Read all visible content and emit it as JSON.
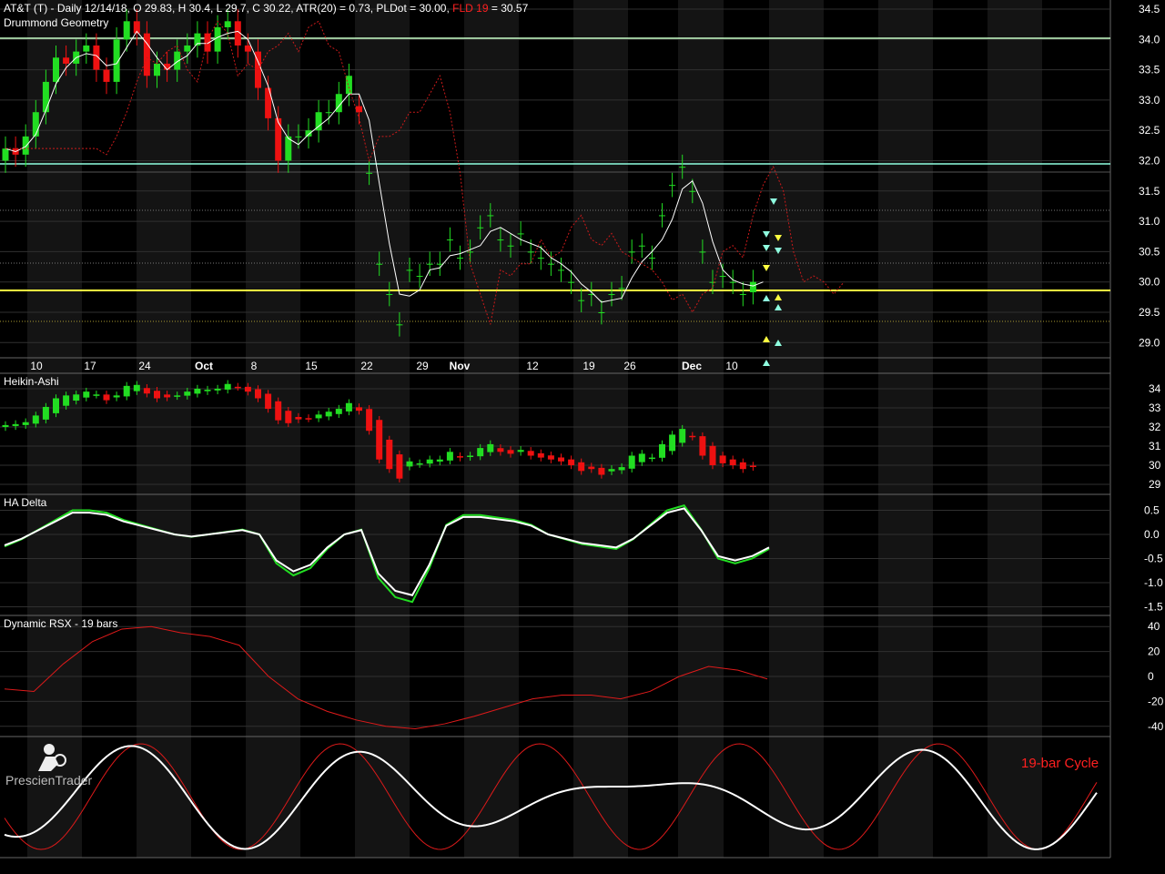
{
  "header": {
    "line1_a": "AT&T (T) - Daily 12/14/18, O 29.83, H 30.4, L 29.7, C 30.22, ATR(20) = 0.73, PLDot = 30.00,",
    "line1_fld": "FLD 19",
    "line1_b": "= 30.57",
    "panel1_title": "Drummond Geometry"
  },
  "panels": {
    "heikin_title": "Heikin-Ashi",
    "delta_title": "HA Delta",
    "rsx_title": "Dynamic RSX - 19 bars",
    "cycle_label": "19-bar Cycle"
  },
  "logo": {
    "text": "PrescienTrader",
    "icon": "trader-figure-icon"
  },
  "colors": {
    "bull": "#22dd22",
    "bear": "#ee1111",
    "grid": "#303030",
    "yellow": "#ffff40",
    "cyan": "#8fffe0"
  },
  "chart_data": [
    {
      "type": "candlestick",
      "title": "AT&T (T) - Daily",
      "x_tick_labels": [
        "10",
        "17",
        "24",
        "Oct",
        "8",
        "15",
        "22",
        "29",
        "Nov",
        "12",
        "19",
        "26",
        "Dec",
        "10"
      ],
      "y_ticks": [
        "34.5",
        "34.0",
        "33.5",
        "33.0",
        "32.5",
        "32.0",
        "31.5",
        "31.0",
        "30.5",
        "30.0",
        "29.5",
        "29.0"
      ],
      "ylim": [
        28.7,
        34.6
      ],
      "closes": [
        32.2,
        32.1,
        32.4,
        32.8,
        33.3,
        33.7,
        33.6,
        33.8,
        33.9,
        33.5,
        33.3,
        34.0,
        34.3,
        34.1,
        33.4,
        33.6,
        33.5,
        33.8,
        33.9,
        34.1,
        33.8,
        34.2,
        34.3,
        33.9,
        33.8,
        33.2,
        32.7,
        32.0,
        32.4,
        32.4,
        32.5,
        32.8,
        32.8,
        33.1,
        33.4,
        32.8,
        31.8,
        30.3,
        29.8,
        29.3,
        30.2,
        30.1,
        30.3,
        30.3,
        30.7,
        30.4,
        30.5,
        30.9,
        31.1,
        30.7,
        30.6,
        30.8,
        30.5,
        30.4,
        30.3,
        30.2,
        30.0,
        29.7,
        29.8,
        29.5,
        29.8,
        29.9,
        30.5,
        30.6,
        30.4,
        31.1,
        31.6,
        31.9,
        31.5,
        30.5,
        30.0,
        30.1,
        30.0,
        29.8,
        30.0,
        30.2
      ],
      "opens": [
        32.0,
        32.2,
        32.1,
        32.4,
        32.8,
        33.3,
        33.7,
        33.6,
        33.8,
        33.9,
        33.5,
        33.3,
        34.0,
        34.3,
        34.1,
        33.4,
        33.6,
        33.5,
        33.8,
        33.9,
        34.1,
        33.8,
        34.2,
        34.3,
        33.9,
        33.8,
        33.2,
        32.7,
        32.0,
        32.4,
        32.4,
        32.5,
        32.8,
        32.8,
        33.1,
        32.9,
        31.8,
        30.3,
        29.8,
        29.3,
        30.2,
        30.1,
        30.3,
        30.3,
        30.7,
        30.4,
        30.5,
        30.9,
        31.1,
        30.7,
        30.6,
        30.8,
        30.5,
        30.4,
        30.3,
        30.2,
        30.0,
        29.7,
        29.8,
        29.5,
        29.8,
        29.9,
        30.5,
        30.6,
        30.4,
        31.1,
        31.6,
        31.9,
        31.5,
        30.5,
        30.0,
        30.1,
        30.0,
        29.8,
        29.83
      ]
    },
    {
      "type": "heikin-ashi",
      "title": "Heikin-Ashi",
      "y_ticks": [
        "34",
        "33",
        "32",
        "31",
        "30",
        "29"
      ],
      "ylim": [
        28.7,
        34.8
      ]
    },
    {
      "type": "line",
      "title": "HA Delta",
      "y_ticks": [
        "0.5",
        "0.0",
        "-0.5",
        "-1.0",
        "-1.5"
      ],
      "ylim": [
        -1.6,
        0.7
      ],
      "values": [
        -0.25,
        -0.1,
        0.1,
        0.3,
        0.5,
        0.5,
        0.45,
        0.3,
        0.2,
        0.1,
        0.0,
        -0.05,
        0.0,
        0.05,
        0.1,
        0.0,
        -0.6,
        -0.85,
        -0.7,
        -0.3,
        0.0,
        0.1,
        -0.9,
        -1.3,
        -1.4,
        -0.7,
        0.2,
        0.4,
        0.4,
        0.35,
        0.3,
        0.2,
        0.0,
        -0.1,
        -0.2,
        -0.25,
        -0.3,
        -0.1,
        0.2,
        0.5,
        0.6,
        0.1,
        -0.5,
        -0.6,
        -0.5,
        -0.3
      ]
    },
    {
      "type": "line",
      "title": "Dynamic RSX - 19 bars",
      "y_ticks": [
        "40",
        "20",
        "0",
        "-20",
        "-40"
      ],
      "ylim": [
        -48,
        48
      ],
      "values": [
        -10,
        -12,
        10,
        28,
        38,
        40,
        35,
        32,
        25,
        0,
        -18,
        -28,
        -35,
        -40,
        -42,
        -38,
        -32,
        -25,
        -18,
        -15,
        -15,
        -18,
        -12,
        0,
        8,
        5,
        -2
      ]
    },
    {
      "type": "line",
      "title": "19-bar Cycle",
      "series": [
        {
          "color": "#ff2020",
          "values": [
            0,
            1,
            0,
            -1,
            0,
            1,
            0,
            -1,
            0,
            1,
            0,
            -1,
            0,
            1,
            0,
            -1,
            0,
            1
          ]
        },
        {
          "color": "#ffffff",
          "values": [
            -1,
            0,
            0.6,
            1,
            0.6,
            -0.4,
            -1,
            -0.5,
            0.5,
            1,
            0.5,
            -0.5,
            -1,
            -0.5,
            0.5,
            1,
            0.5,
            -0.2
          ]
        }
      ]
    }
  ]
}
